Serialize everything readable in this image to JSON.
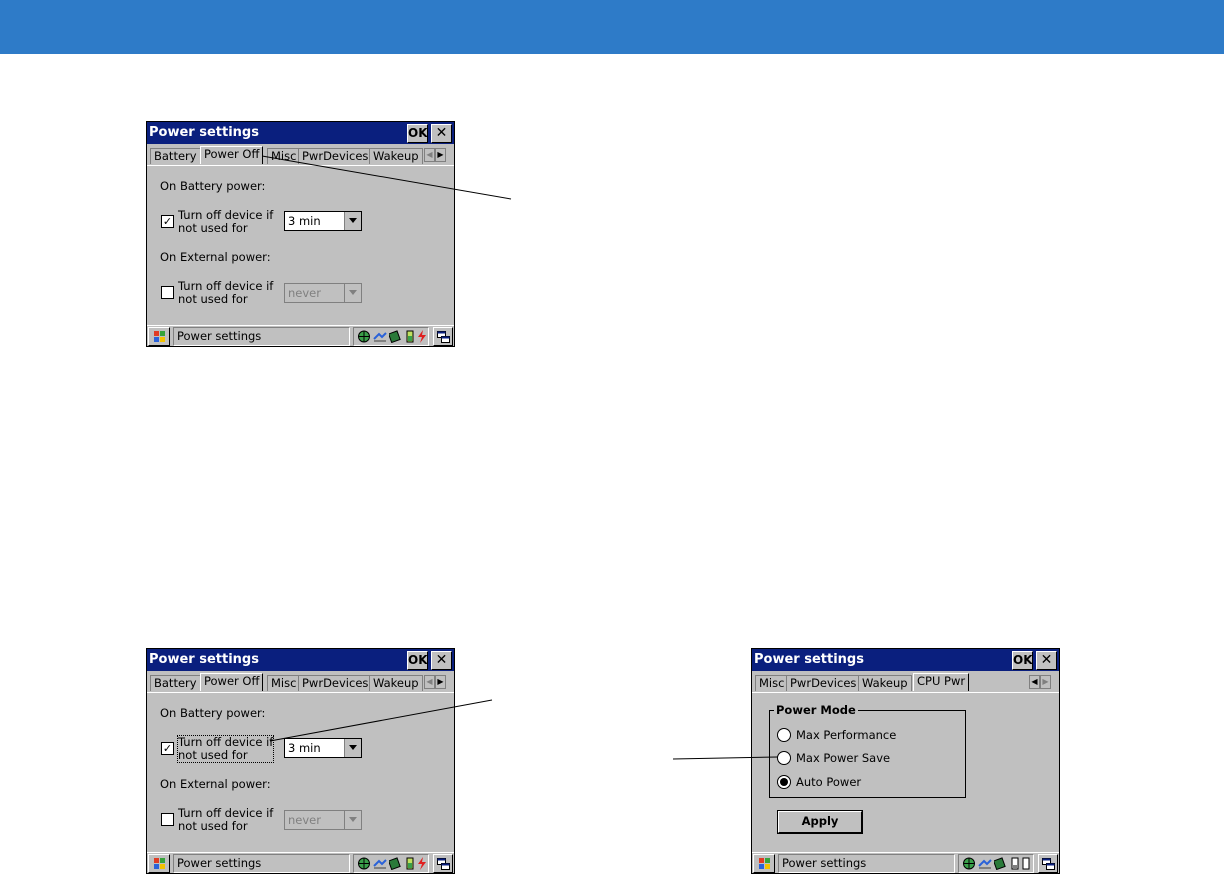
{
  "screens": [
    {
      "title": "Power settings",
      "ok_label": "OK",
      "close_glyph": "✕",
      "tabs": [
        "Battery",
        "Power Off",
        "Misc",
        "PwrDevices",
        "Wakeup"
      ],
      "active_tab": "Power Off",
      "battery_heading": "On Battery power:",
      "battery_check_line1": "Turn off device if",
      "battery_check_line2": "not used for",
      "battery_checked": true,
      "battery_value": "3 min",
      "external_heading": "On External power:",
      "external_check_line1": "Turn off device if",
      "external_check_line2": "not used for",
      "external_checked": false,
      "external_value": "never",
      "taskbar_title": "Power settings"
    },
    {
      "title": "Power settings",
      "ok_label": "OK",
      "close_glyph": "✕",
      "tabs": [
        "Battery",
        "Power Off",
        "Misc",
        "PwrDevices",
        "Wakeup"
      ],
      "active_tab": "Power Off",
      "battery_heading": "On Battery power:",
      "battery_check_line1": "Turn off device if",
      "battery_check_line2": "not used for",
      "battery_checked": true,
      "battery_value": "3 min",
      "external_heading": "On External power:",
      "external_check_line1": "Turn off device if",
      "external_check_line2": "not used for",
      "external_checked": false,
      "external_value": "never",
      "taskbar_title": "Power settings"
    },
    {
      "title": "Power settings",
      "ok_label": "OK",
      "close_glyph": "✕",
      "tabs": [
        "Misc",
        "PwrDevices",
        "Wakeup",
        "CPU Pwr"
      ],
      "active_tab": "CPU Pwr",
      "group_title": "Power Mode",
      "options": [
        "Max Performance",
        "Max Power Save",
        "Auto Power"
      ],
      "selected_option": "Auto Power",
      "apply_label": "Apply",
      "taskbar_title": "Power settings"
    }
  ],
  "colors": {
    "top_band": "#2e7bc8",
    "title_bar": "#0a1f7e",
    "window_bg": "#c0c0c0"
  }
}
